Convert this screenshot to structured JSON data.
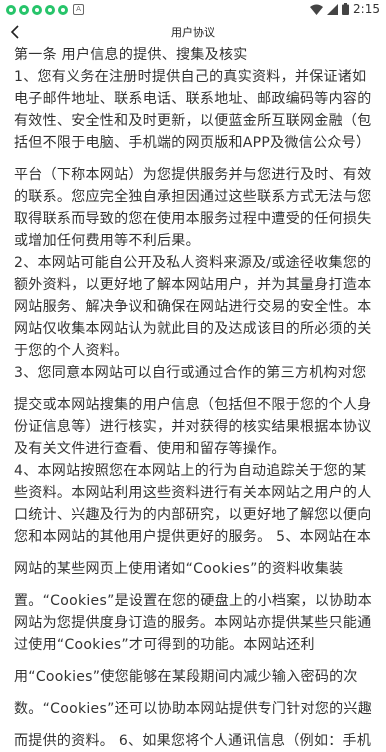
{
  "status_bar": {
    "time": "2:15",
    "icons": [
      "app-notification-icon",
      "app-notification-icon",
      "app-notification-icon",
      "app-notification-icon",
      "app-notification-icon",
      "a-icon"
    ],
    "right_icons": [
      "wifi-icon",
      "signal-icon",
      "battery-icon"
    ]
  },
  "nav": {
    "title": "用户协议",
    "back_icon": "chevron-left-icon"
  },
  "content": {
    "lines": [
      "第一条 用户信息的提供、搜集及核实",
      "1、您有义务在注册时提供自己的真实资料，并保证诸如",
      "电子邮件地址、联系电话、联系地址、邮政编码等内容的",
      "有效性、安全性和及时更新，以便蓝金所互联网金融（包",
      "括但不限于电脑、手机端的网页版和APP及微信公众号）"
    ],
    "lines2": [
      "平台（下称本网站）为您提供服务并与您进行及时、有效",
      "的联系。您应完全独自承担因通过这些联系方式无法与您",
      "取得联系而导致的您在使用本服务过程中遭受的任何损失",
      "或增加任何费用等不利后果。",
      "2、本网站可能自公开及私人资料来源及/或途径收集您的",
      "额外资料，以更好地了解本网站用户，并为其量身打造本",
      "网站服务、解决争议和确保在网站进行交易的安全性。本",
      "网站仅收集本网站认为就此目的及达成该目的所必须的关",
      "于您的个人资料。",
      "3、您同意本网站可以自行或通过合作的第三方机构对您"
    ],
    "lines3": [
      "提交或本网站搜集的用户信息（包括但不限于您的个人身",
      "份证信息等）进行核实，并对获得的核实结果根据本协议",
      "及有关文件进行查看、使用和留存等操作。",
      "4、本网站按照您在本网站上的行为自动追踪关于您的某",
      "些资料。本网站利用这些资料进行有关本网站之用户的人",
      "口统计、兴趣及行为的内部研究，以更好地了解您以便向",
      "您和本网站的其他用户提供更好的服务。 5、本网站在本"
    ],
    "lines4": [
      "网站的某些网页上使用诸如“Cookies”的资料收集装"
    ],
    "lines5": [
      "置。“Cookies”是设置在您的硬盘上的小档案，以协助本",
      "网站为您提供度身订造的服务。本网站亦提供某些只能通",
      "过使用“Cookies”才可得到的功能。本网站还利"
    ],
    "lines6": [
      "用“Cookies”使您能够在某段期间内减少输入密码的次"
    ],
    "lines7": [
      "数。“Cookies”还可以协助本网站提供专门针对您的兴趣"
    ],
    "lines8": [
      "而提供的资料。 6、如果您将个人通讯信息（例如：手机"
    ]
  }
}
